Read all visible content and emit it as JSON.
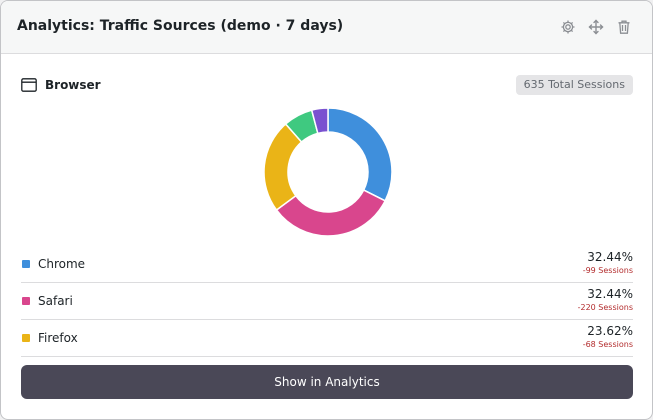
{
  "widget": {
    "title": "Analytics: Traffic Sources (demo · 7 days)",
    "actions": [
      {
        "name": "settings",
        "icon": "gear-icon"
      },
      {
        "name": "move",
        "icon": "move-arrows-icon"
      },
      {
        "name": "delete",
        "icon": "trash-icon"
      }
    ]
  },
  "section": {
    "title": "Browser",
    "icon": "browser-window-icon",
    "total_badge": "635 Total Sessions"
  },
  "colors": {
    "chrome": "#3f8fdc",
    "safari": "#d9468d",
    "firefox": "#eab417",
    "other_green": "#3fc980",
    "other_purple": "#7a52d0",
    "negative": "#b32d2e",
    "button_bg": "#4a4857"
  },
  "chart_data": {
    "type": "pie",
    "categories": [
      "Chrome",
      "Safari",
      "Firefox",
      "",
      ""
    ],
    "values": [
      32.44,
      32.44,
      23.62,
      7.4,
      4.1
    ]
  },
  "legend": [
    {
      "label": "Chrome",
      "percent": "32.44%",
      "delta": "-99 Sessions"
    },
    {
      "label": "Safari",
      "percent": "32.44%",
      "delta": "-220 Sessions"
    },
    {
      "label": "Firefox",
      "percent": "23.62%",
      "delta": "-68 Sessions"
    },
    {
      "label": "",
      "percent": "7.40%",
      "delta": ""
    }
  ],
  "cta": {
    "label": "Show in Analytics"
  }
}
